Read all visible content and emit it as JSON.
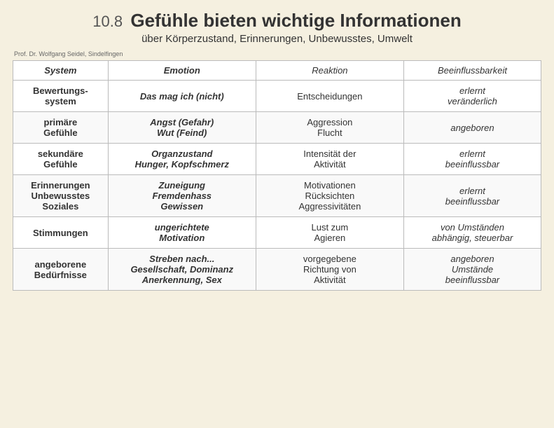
{
  "header": {
    "number": "10.8",
    "title": "Gefühle bieten wichtige Informationen",
    "subtitle": "über Körperzustand, Erinnerungen, Unbewusstes, Umwelt",
    "author": "Prof. Dr. Wolfgang Seidel, Sindelfingen"
  },
  "table": {
    "columns": [
      {
        "key": "system",
        "label": "System"
      },
      {
        "key": "emotion",
        "label": "Emotion"
      },
      {
        "key": "reaktion",
        "label": "Reaktion"
      },
      {
        "key": "beeinflussbarkeit",
        "label": "Beeinflussbarkeit"
      }
    ],
    "rows": [
      {
        "system": "Bewertungs-\nsystem",
        "emotion": "Das mag ich (nicht)",
        "reaktion": "Entscheidungen",
        "beeinflussbarkeit": "erlernt\nveränderlich"
      },
      {
        "system": "primäre\nGefühle",
        "emotion": "Angst (Gefahr)\nWut (Feind)",
        "reaktion": "Aggression\nFlucht",
        "beeinflussbarkeit": "angeboren"
      },
      {
        "system": "sekundäre\nGefühle",
        "emotion": "Organzustand\nHunger, Kopfschmerz",
        "reaktion": "Intensität der\nAktivität",
        "beeinflussbarkeit": "erlernt\nbeeinflussbar"
      },
      {
        "system": "Erinnerungen\nUnbewusstes\nSoziales",
        "emotion": "Zuneigung\nFremdenhass\nGewissen",
        "reaktion": "Motivationen\nRücksichten\nAggressivitäten",
        "beeinflussbarkeit": "erlernt\nbeeinflussbar"
      },
      {
        "system": "Stimmungen",
        "emotion": "ungerichtete\nMotivation",
        "reaktion": "Lust zum\nAgieren",
        "beeinflussbarkeit": "von Umständen\nabhängig, steuerbar"
      },
      {
        "system": "angeborene\nBedürfnisse",
        "emotion": "Streben nach...\nGesellschaft, Dominanz\nAnerkennung, Sex",
        "reaktion": "vorgegebene\nRichtung von\nAktivität",
        "beeinflussbarkeit": "angeboren\nUmstände\nbeeinflussbar"
      }
    ]
  }
}
